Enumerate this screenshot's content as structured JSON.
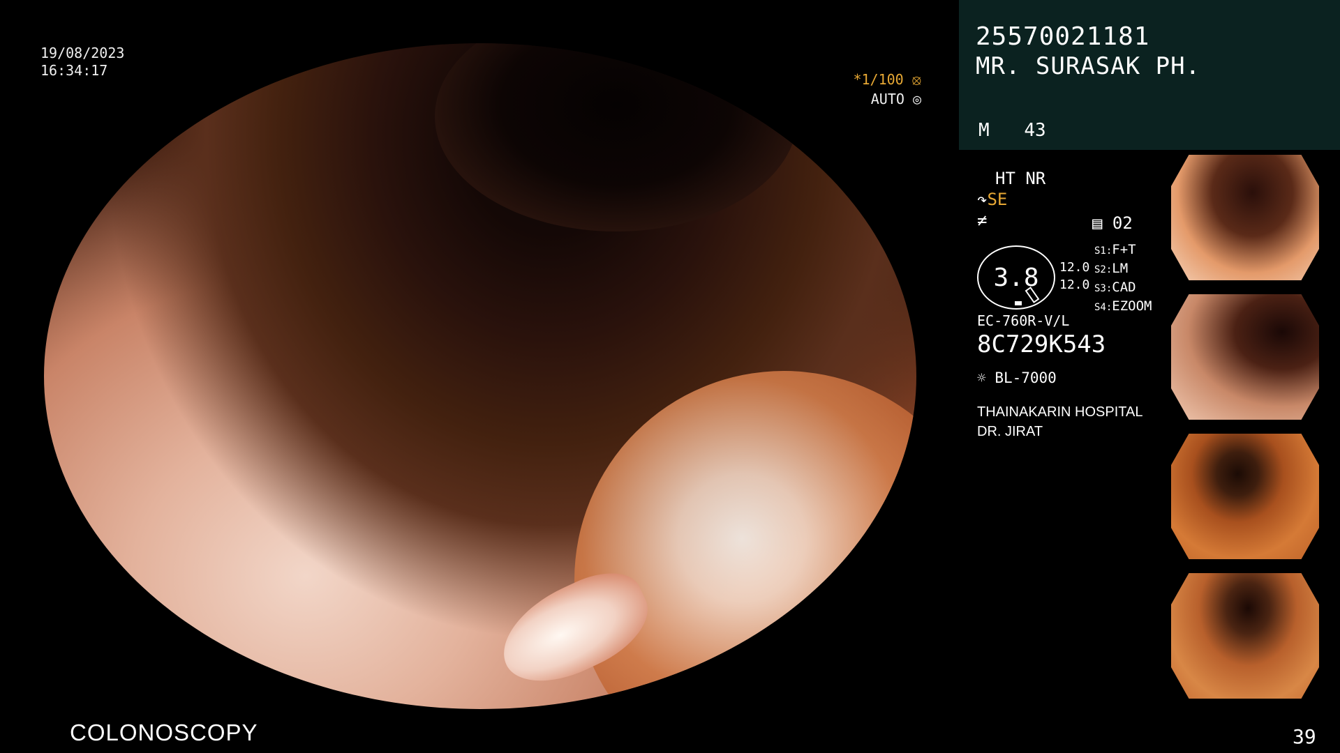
{
  "datetime": {
    "date": "19/08/2023",
    "time": "16:34:17"
  },
  "shutter": {
    "speed": "*1/100",
    "speed_icon": "shutter-icon",
    "iris": "AUTO",
    "iris_icon": "iris-icon"
  },
  "patient": {
    "id": "25570021181",
    "name": "MR. SURASAK PH.",
    "sex": "M",
    "age": "43"
  },
  "settings": {
    "ht_nr": "HT NR",
    "mode": "SE",
    "mode_icon": "structure-enhance-icon",
    "color_icon": "color-enhance-icon",
    "memory_icon": "memory-icon",
    "memory": "02",
    "gauge_value": "3.8",
    "gauge_left_1": "12.0",
    "gauge_left_2": "12.0",
    "switches": [
      {
        "key": "S1:",
        "value": "F+T"
      },
      {
        "key": "S2:",
        "value": "LM"
      },
      {
        "key": "S3:",
        "value": "CAD"
      },
      {
        "key": "S4:",
        "value": "EZOOM"
      }
    ],
    "scope_model": "EC-760R-V/L",
    "scope_serial": "8C729K543",
    "light_icon": "light-source-icon",
    "light_source": "BL-7000",
    "hospital": "THAINAKARIN HOSPITAL",
    "doctor": "DR. JIRAT"
  },
  "procedure": "COLONOSCOPY",
  "image_count": "39",
  "colors": {
    "accent": "#e7a834",
    "panel": "#0b2220"
  }
}
